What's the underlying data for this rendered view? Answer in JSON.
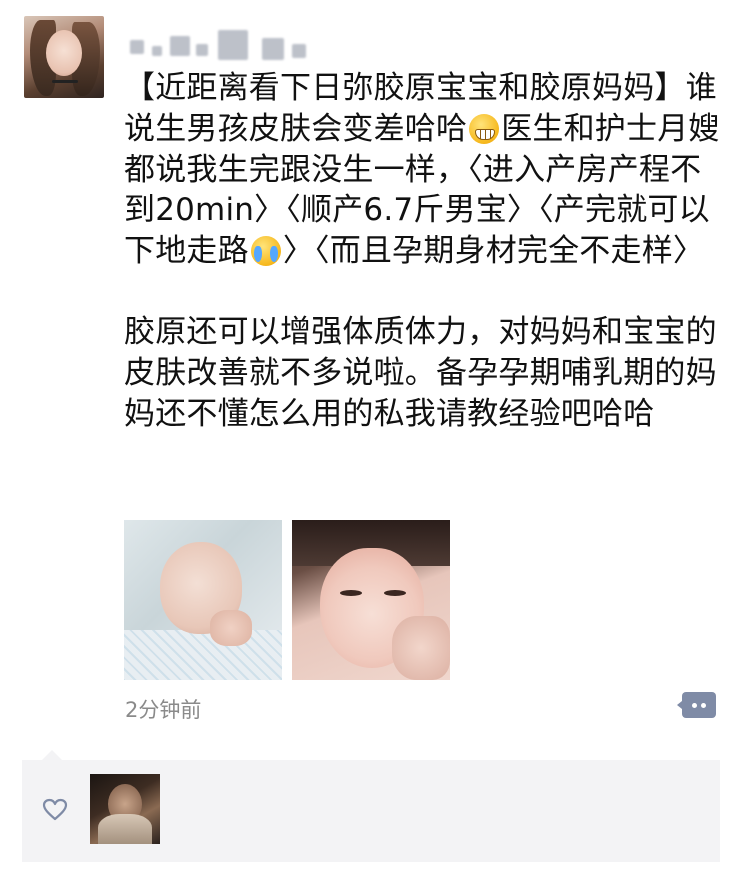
{
  "post": {
    "author_avatar_icon": "user-avatar",
    "paragraphs": [
      {
        "segments": [
          "【近距离看下日弥胶原宝宝和胶原妈妈】谁说生男孩皮肤会变差哈哈",
          "医生和护士月嫂都说我生完跟没生一样，〈进入产房产程不到20min〉〈顺产6.7斤男宝〉〈产完就可以下地走路",
          "〉〈而且孕期身材完全不走样〉"
        ],
        "emojis": [
          "grimacing-emoji",
          "crying-laughing-emoji"
        ]
      },
      {
        "text": "胶原还可以增强体质体力，对妈妈和宝宝的皮肤改善就不多说啦。备孕孕期哺乳期的妈妈还不懂怎么用的私我请教经验吧哈哈"
      }
    ],
    "images": [
      {
        "name": "baby-photo"
      },
      {
        "name": "mother-photo"
      }
    ],
    "time": "2分钟前",
    "more_icon": "comment-more-icon"
  },
  "likes": {
    "heart_icon": "heart-icon",
    "count_avatars": 1
  },
  "colors": {
    "time_gray": "#8a8a8a",
    "more_button": "#7f8ba6",
    "likes_bg": "#f3f3f5"
  }
}
